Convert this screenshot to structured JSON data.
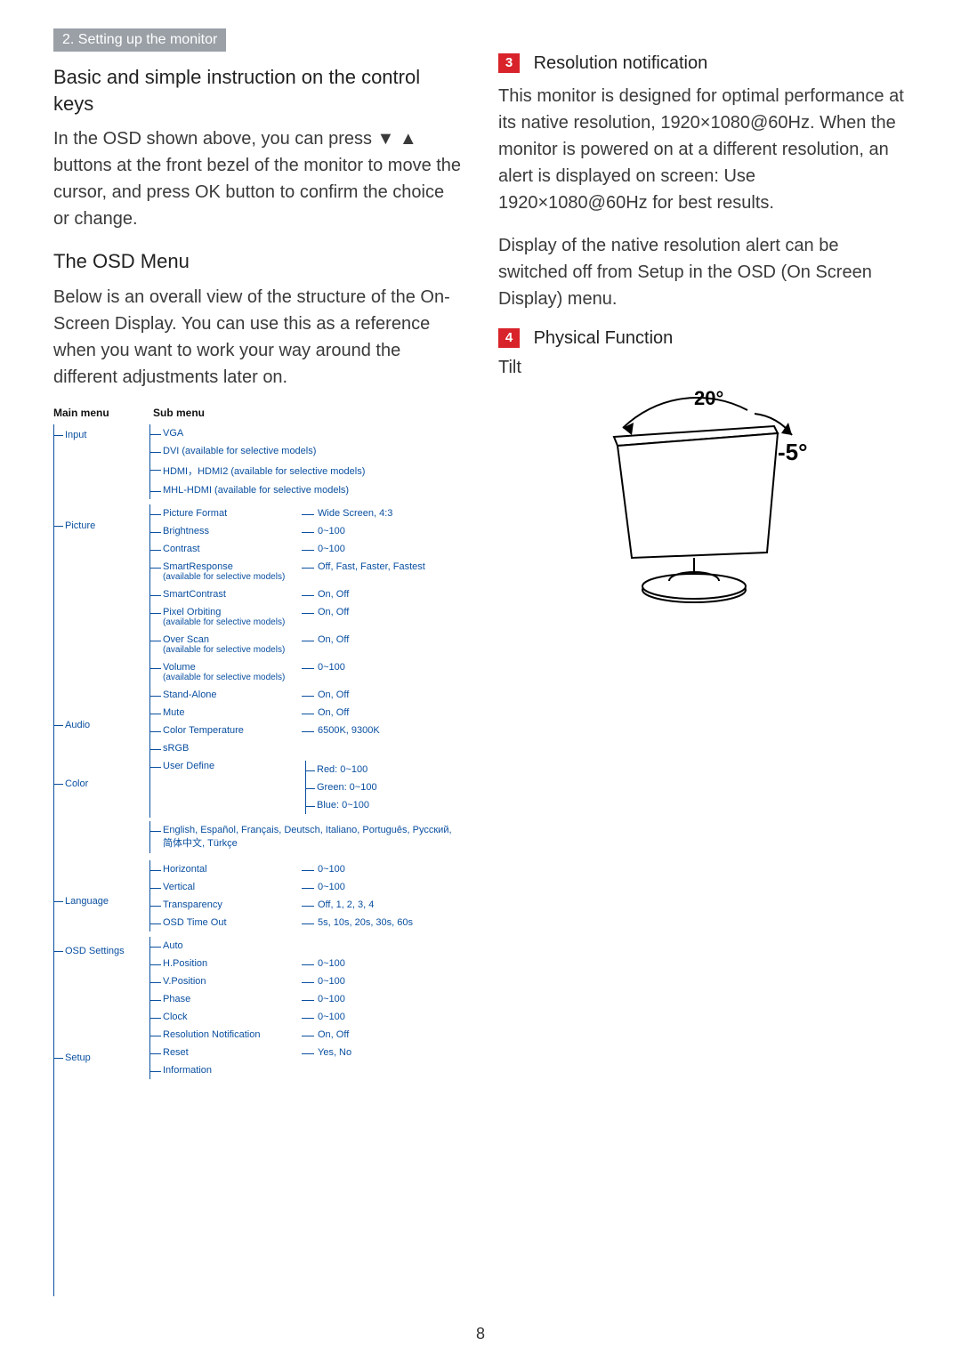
{
  "chapter": "2. Setting up the monitor",
  "left": {
    "h_basic": "Basic and simple instruction on the control keys",
    "p_basic": "In the OSD shown above, you can press ▼ ▲ buttons at the front bezel of the monitor to move the cursor, and press OK button to confirm the choice or change.",
    "h_osd": "The OSD Menu",
    "p_osd": "Below is an overall view of the structure of the On-Screen Display. You can use this as a reference when you want to work your way around the different adjustments later on."
  },
  "osd": {
    "head_main": "Main menu",
    "head_sub": "Sub menu",
    "main": [
      "Input",
      "Picture",
      "Audio",
      "Color",
      "Language",
      "OSD Settings",
      "Setup"
    ],
    "input": [
      {
        "l": "VGA"
      },
      {
        "l": "DVI (available for selective models)"
      },
      {
        "l": "HDMI，HDMI2 (available for selective models)"
      },
      {
        "l": "MHL-HDMI (available for selective models)"
      }
    ],
    "picture": [
      {
        "l": "Picture Format",
        "v": "Wide Screen, 4:3"
      },
      {
        "l": "Brightness",
        "v": "0~100"
      },
      {
        "l": "Contrast",
        "v": "0~100"
      },
      {
        "l": "SmartResponse",
        "n": "(available for selective models)",
        "v": "Off, Fast, Faster, Fastest"
      },
      {
        "l": "SmartContrast",
        "v": "On, Off"
      },
      {
        "l": "Pixel Orbiting",
        "n": "(available for selective models)",
        "v": "On, Off"
      },
      {
        "l": "Over Scan",
        "n": "(available for selective models)",
        "v": "On, Off"
      }
    ],
    "audio": [
      {
        "l": "Volume",
        "n": "(available for selective models)",
        "v": "0~100"
      },
      {
        "l": "Stand-Alone",
        "v": "On, Off"
      },
      {
        "l": "Mute",
        "v": "On, Off"
      }
    ],
    "color": [
      {
        "l": "Color Temperature",
        "v": "6500K, 9300K"
      },
      {
        "l": "sRGB"
      },
      {
        "l": "User Define",
        "multi": [
          "Red: 0~100",
          "Green: 0~100",
          "Blue: 0~100"
        ]
      }
    ],
    "language": [
      {
        "l": "English, Español, Français, Deutsch, Italiano, Português, Русский, 简体中文, Türkçe"
      }
    ],
    "osd_settings": [
      {
        "l": "Horizontal",
        "v": "0~100"
      },
      {
        "l": "Vertical",
        "v": "0~100"
      },
      {
        "l": "Transparency",
        "v": "Off, 1, 2, 3, 4"
      },
      {
        "l": "OSD Time Out",
        "v": "5s, 10s, 20s, 30s, 60s"
      }
    ],
    "setup": [
      {
        "l": "Auto"
      },
      {
        "l": "H.Position",
        "v": "0~100"
      },
      {
        "l": "V.Position",
        "v": "0~100"
      },
      {
        "l": "Phase",
        "v": "0~100"
      },
      {
        "l": "Clock",
        "v": "0~100"
      },
      {
        "l": "Resolution Notification",
        "v": "On, Off"
      },
      {
        "l": "Reset",
        "v": "Yes, No"
      },
      {
        "l": "Information"
      }
    ]
  },
  "right": {
    "num3": "3",
    "h3": "Resolution notification",
    "p3a": "This monitor is designed for optimal performance at its native resolution, 1920×1080@60Hz. When the monitor is powered on at a different resolution, an alert is displayed on screen: Use 1920×1080@60Hz for best results.",
    "p3b": "Display of the native resolution alert can be switched off from Setup in the OSD (On Screen Display) menu.",
    "num4": "4",
    "h4": "Physical Function",
    "tilt": "Tilt",
    "angle20": "20°",
    "angle5": "-5°"
  },
  "page_num": "8"
}
